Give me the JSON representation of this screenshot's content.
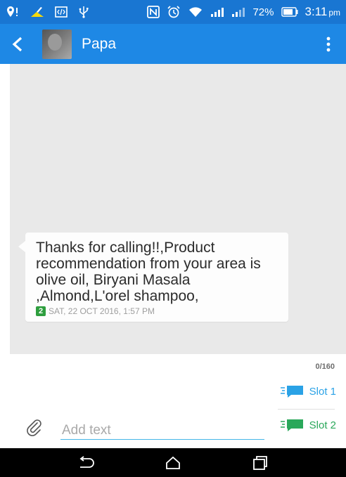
{
  "status_bar": {
    "battery_percent": "72%",
    "time": "3:11",
    "ampm": "pm"
  },
  "app_bar": {
    "contact_name": "Papa"
  },
  "message": {
    "text": "Thanks for calling!!,Product recommendation from your area is olive oil, Biryani Masala ,Almond,L'orel shampoo,",
    "sim": "2",
    "timestamp": "SAT, 22 OCT 2016, 1:57 PM"
  },
  "compose": {
    "char_count": "0/160",
    "slot1_label": "Slot 1",
    "slot2_label": "Slot 2",
    "placeholder": "Add text",
    "value": ""
  },
  "colors": {
    "status_bar": "#1976d2",
    "app_bar": "#1e88e5",
    "conversation_bg": "#e9e9e9",
    "slot1": "#2aa2e6",
    "slot2": "#2aa85a"
  }
}
